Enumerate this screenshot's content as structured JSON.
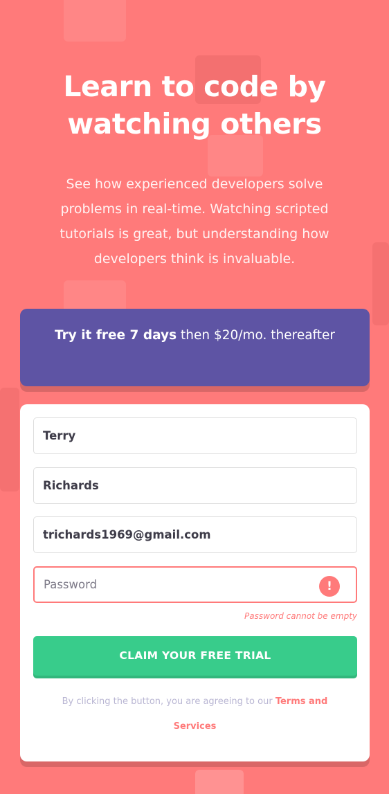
{
  "hero": {
    "title": "Learn to code by watching others",
    "description": "See how experienced developers solve problems in real-time. Watching scripted tutorials is great, but understanding how developers think is invaluable."
  },
  "promo": {
    "bold": "Try it free 7 days",
    "rest": "then $20/mo. thereafter"
  },
  "form": {
    "first_name_value": "Terry",
    "last_name_value": "Richards",
    "email_value": "trichards1969@gmail.com",
    "password_placeholder": "Password",
    "password_error": "Password cannot be empty",
    "submit_label": "CLAIM YOUR FREE TRIAL",
    "terms_text": "By clicking the button, you are agreeing to our",
    "terms_link": "Terms and Services"
  },
  "icons": {
    "error": "exclamation-icon"
  },
  "colors": {
    "background": "#ff7a7a",
    "promo": "#5e54a4",
    "accent_green": "#38cc8b",
    "error": "#ff7a7a"
  }
}
